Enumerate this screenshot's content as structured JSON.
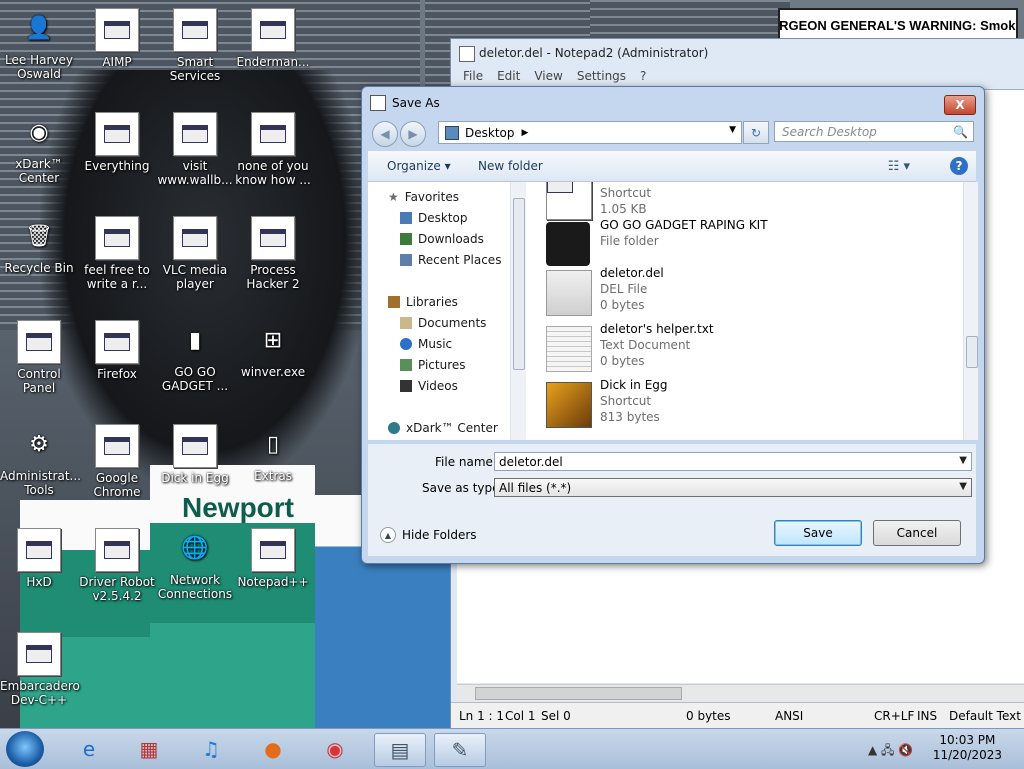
{
  "desktop": {
    "billboard_text": "SURGEON GENERAL'S WARNING: Smoking",
    "carton_brand": "Newport",
    "icons": [
      {
        "label": "Lee Harvey Oswald",
        "glyph": "👤"
      },
      {
        "label": "AIMP",
        "glyph": ""
      },
      {
        "label": "Smart Services",
        "glyph": ""
      },
      {
        "label": "Enderman...",
        "glyph": ""
      },
      {
        "label": "xDark™ Center",
        "glyph": "◉"
      },
      {
        "label": "Everything",
        "glyph": ""
      },
      {
        "label": "visit www.wallb...",
        "glyph": ""
      },
      {
        "label": "none of you know how ...",
        "glyph": ""
      },
      {
        "label": "Recycle Bin",
        "glyph": "🗑"
      },
      {
        "label": "feel free to write a r...",
        "glyph": ""
      },
      {
        "label": "VLC media player",
        "glyph": ""
      },
      {
        "label": "Process Hacker 2",
        "glyph": ""
      },
      {
        "label": "Control Panel",
        "glyph": ""
      },
      {
        "label": "Firefox",
        "glyph": ""
      },
      {
        "label": "GO GO GADGET ...",
        "glyph": "▮"
      },
      {
        "label": "winver.exe",
        "glyph": "⊞"
      },
      {
        "label": "Administrat... Tools",
        "glyph": "⚙"
      },
      {
        "label": "Google Chrome",
        "glyph": ""
      },
      {
        "label": "Dick in Egg",
        "glyph": ""
      },
      {
        "label": "Extras",
        "glyph": "▯"
      },
      {
        "label": "HxD",
        "glyph": ""
      },
      {
        "label": "Driver Robot v2.5.4.2",
        "glyph": ""
      },
      {
        "label": "Network Connections",
        "glyph": "🌐"
      },
      {
        "label": "Notepad++",
        "glyph": ""
      },
      {
        "label": "Embarcadero Dev-C++",
        "glyph": ""
      }
    ]
  },
  "notepad": {
    "title": "deletor.del - Notepad2 (Administrator)",
    "menu": [
      "File",
      "Edit",
      "View",
      "Settings",
      "?"
    ],
    "status": {
      "position": "Ln 1 : 1",
      "col": "Col 1",
      "sel": "Sel 0",
      "size": "0 bytes",
      "encoding": "ANSI",
      "eol": "CR+LF",
      "mode": "INS",
      "scheme": "Default Text"
    }
  },
  "dialog": {
    "title": "Save As",
    "close_glyph": "X",
    "back_glyph": "◀",
    "forward_glyph": "▶",
    "address": "Desktop",
    "address_arrow": "▶",
    "dropdown_glyph": "▼",
    "refresh_glyph": "↻",
    "search_placeholder": "Search Desktop",
    "search_glyph": "🔍",
    "organize": "Organize ▾",
    "new_folder": "New folder",
    "views_glyph": "☷ ▾",
    "help_glyph": "?",
    "nav": {
      "favorites": "Favorites",
      "desktop": "Desktop",
      "downloads": "Downloads",
      "recent": "Recent Places",
      "libraries": "Libraries",
      "documents": "Documents",
      "music": "Music",
      "pictures": "Pictures",
      "videos": "Videos",
      "xdark": "xDark™ Center"
    },
    "files": [
      {
        "name": "",
        "type": "Shortcut",
        "size": "1.05 KB"
      },
      {
        "name": "GO GO GADGET RAPING KIT",
        "type": "File folder",
        "size": ""
      },
      {
        "name": "deletor.del",
        "type": "DEL File",
        "size": "0 bytes"
      },
      {
        "name": "deletor's helper.txt",
        "type": "Text Document",
        "size": "0 bytes"
      },
      {
        "name": "Dick in Egg",
        "type": "Shortcut",
        "size": "813 bytes"
      }
    ],
    "file_name_label": "File name:",
    "file_name_value": "deletor.del",
    "save_type_label": "Save as type:",
    "save_type_value": "All files (*.*)",
    "save_button": "Save",
    "cancel_button": "Cancel",
    "hide_folders": "Hide Folders",
    "hide_glyph": "▲"
  },
  "taskbar": {
    "time": "10:03 PM",
    "date": "11/20/2023",
    "tray_glyphs": "▲ 🖧 🔇"
  }
}
